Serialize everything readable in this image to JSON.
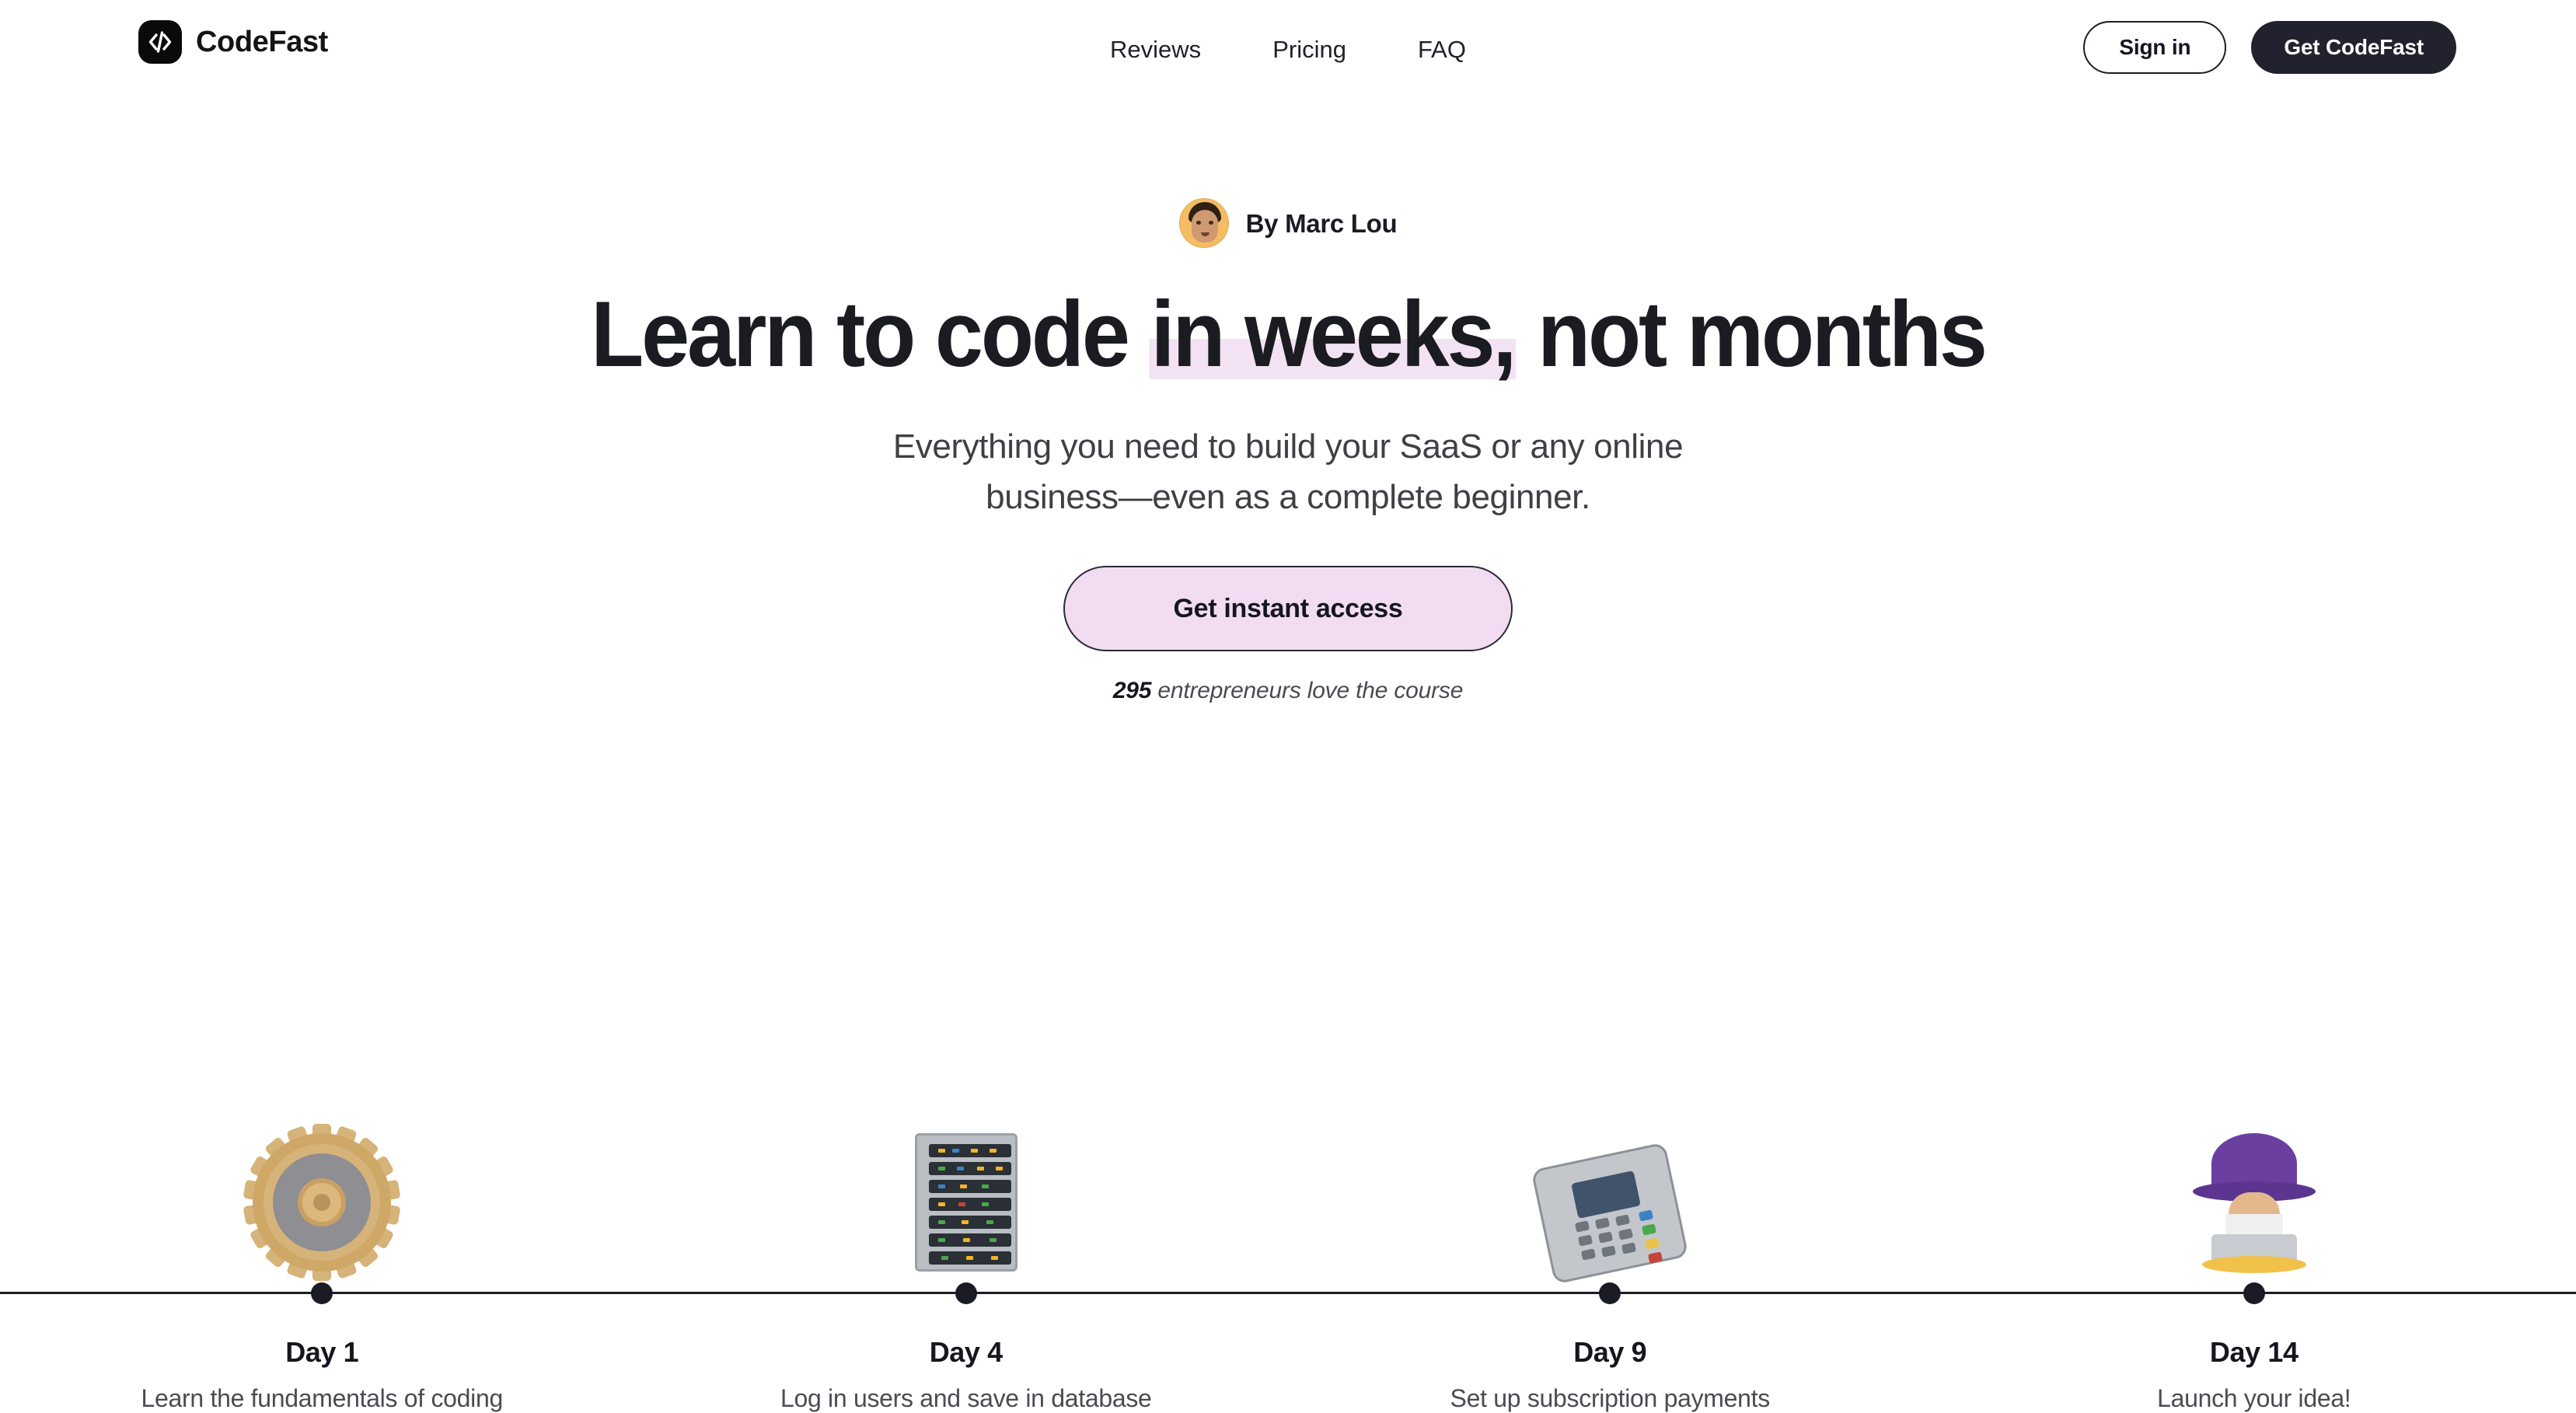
{
  "header": {
    "brand": {
      "name": "CodeFast",
      "logo_icon": "code-brackets-icon"
    },
    "nav": [
      {
        "label": "Reviews"
      },
      {
        "label": "Pricing"
      },
      {
        "label": "FAQ"
      }
    ],
    "signin_label": "Sign in",
    "cta_label": "Get CodeFast"
  },
  "hero": {
    "byline": "By Marc Lou",
    "avatar_icon": "author-avatar",
    "headline_pre": "Learn to code ",
    "headline_highlight": "in weeks,",
    "headline_post": " not months",
    "subhead_line1": "Everything you need to build your SaaS or any online",
    "subhead_line2": "business—even as a complete beginner.",
    "cta_label": "Get instant access",
    "social_proof_count": "295",
    "social_proof_text": " entrepreneurs love the course"
  },
  "timeline": [
    {
      "emoji": "⚙️",
      "emoji_name": "gear-emoji",
      "day": "Day 1",
      "desc": "Learn the fundamentals of coding"
    },
    {
      "emoji": "🗄️",
      "emoji_name": "server-rack-emoji",
      "day": "Day 4",
      "desc": "Log in users and save in database"
    },
    {
      "emoji": "💳",
      "emoji_name": "card-terminal-emoji",
      "day": "Day 9",
      "desc": "Set up subscription payments"
    },
    {
      "emoji": "🧙",
      "emoji_name": "wizard-laptop-emoji",
      "day": "Day 14",
      "desc": "Launch your idea!"
    }
  ],
  "colors": {
    "ink": "#1b1b26",
    "dark_button": "#22222e",
    "highlight_pink": "#f3e2f3",
    "cta_pink": "#f2dcf2",
    "muted_text": "#4b4b54",
    "avatar_bg": "#f5bc63"
  }
}
